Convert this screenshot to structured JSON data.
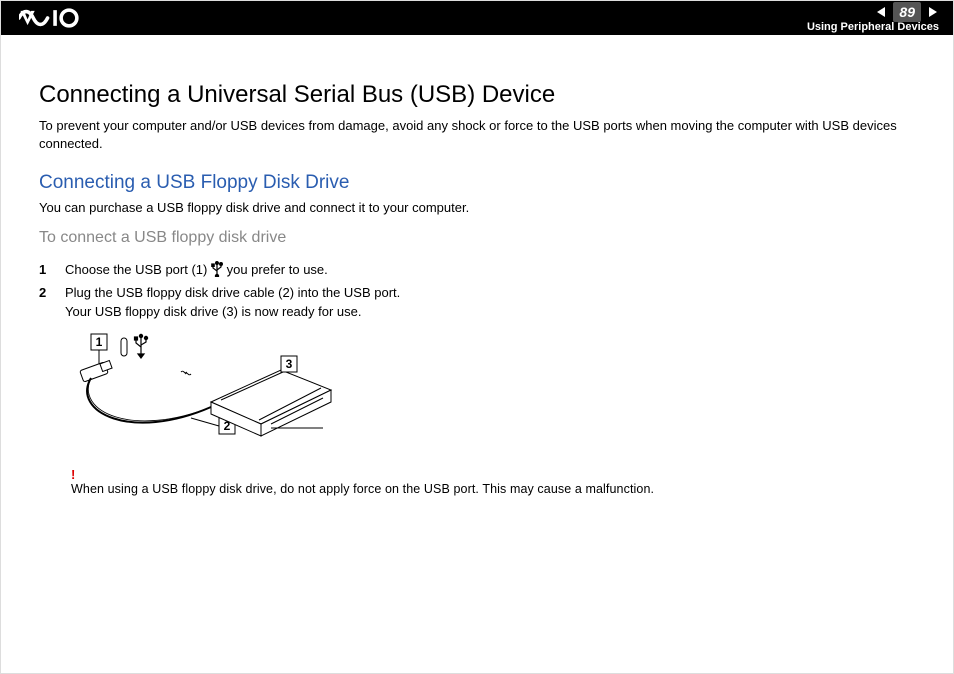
{
  "header": {
    "page_number": "89",
    "section": "Using Peripheral Devices"
  },
  "title": "Connecting a Universal Serial Bus (USB) Device",
  "intro": "To prevent your computer and/or USB devices from damage, avoid any shock or force to the USB ports when moving the computer with USB devices connected.",
  "subheading": "Connecting a USB Floppy Disk Drive",
  "subintro": "You can purchase a USB floppy disk drive and connect it to your computer.",
  "procedure_title": "To connect a USB floppy disk drive",
  "steps": [
    {
      "num": "1",
      "text_before": "Choose the USB port (1) ",
      "text_after": " you prefer to use."
    },
    {
      "num": "2",
      "text_before": "Plug the USB floppy disk drive cable (2) into the USB port.",
      "text_after": "",
      "line2": "Your USB floppy disk drive (3) is now ready for use."
    }
  ],
  "diagram": {
    "callouts": {
      "c1": "1",
      "c2": "2",
      "c3": "3"
    }
  },
  "warning": {
    "symbol": "!",
    "text": "When using a USB floppy disk drive, do not apply force on the USB port. This may cause a malfunction."
  }
}
